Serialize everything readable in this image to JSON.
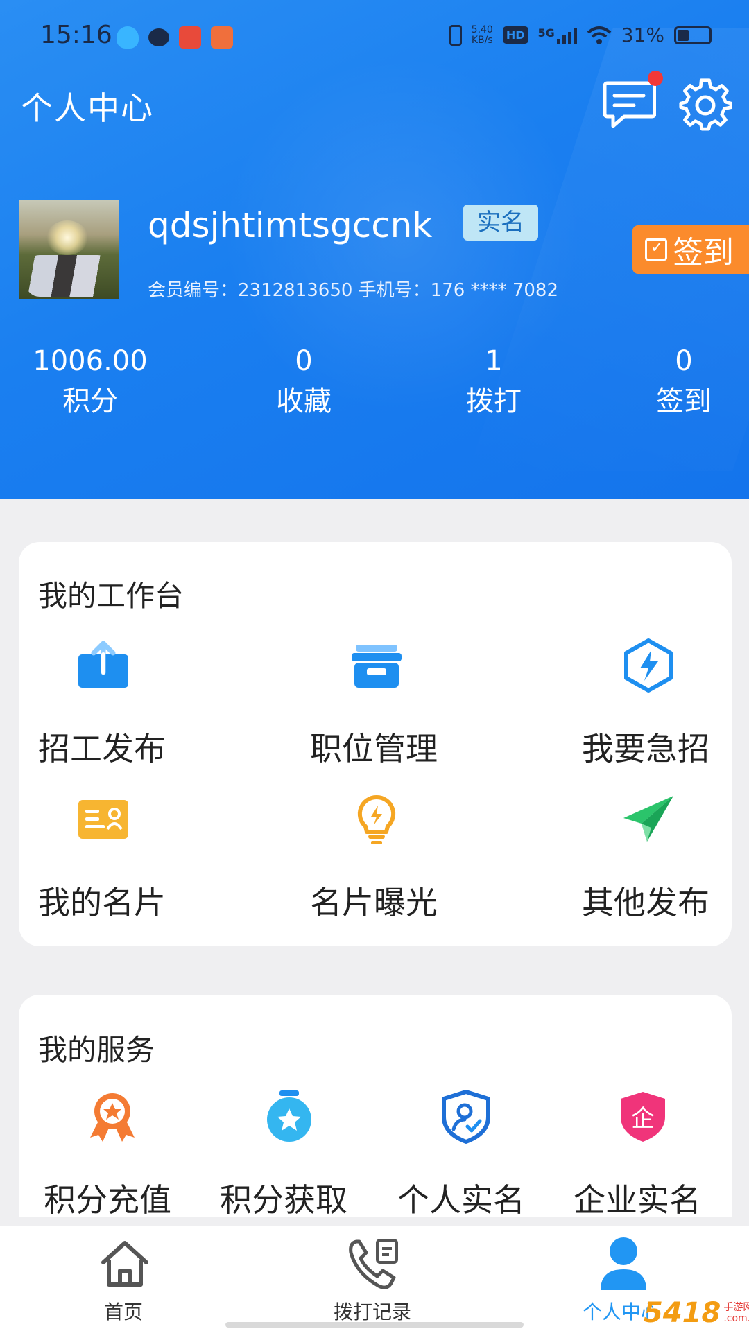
{
  "status_bar": {
    "time": "15:16",
    "net_speed_value": "5.40",
    "net_speed_unit": "KB/s",
    "hd": "HD",
    "network": "5G",
    "battery": "31%"
  },
  "header": {
    "title": "个人中心",
    "username": "qdsjhtimtsgccnk",
    "verified_badge": "实名",
    "member_info": "会员编号：2312813650 手机号：176 **** 7082",
    "checkin_label": "签到"
  },
  "stats": [
    {
      "value": "1006.00",
      "label": "积分"
    },
    {
      "value": "0",
      "label": "收藏"
    },
    {
      "value": "1",
      "label": "拨打"
    },
    {
      "value": "0",
      "label": "签到"
    }
  ],
  "workbench": {
    "title": "我的工作台",
    "items": [
      {
        "label": "招工发布",
        "icon": "upload-icon"
      },
      {
        "label": "职位管理",
        "icon": "archive-box-icon"
      },
      {
        "label": "我要急招",
        "icon": "lightning-icon"
      },
      {
        "label": "我的名片",
        "icon": "business-card-icon"
      },
      {
        "label": "名片曝光",
        "icon": "lightbulb-icon"
      },
      {
        "label": "其他发布",
        "icon": "paper-plane-icon"
      }
    ]
  },
  "services": {
    "title": "我的服务",
    "items": [
      {
        "label": "积分充值",
        "icon": "medal-icon"
      },
      {
        "label": "积分获取",
        "icon": "star-badge-icon"
      },
      {
        "label": "个人实名",
        "icon": "person-shield-icon"
      },
      {
        "label": "企业实名",
        "icon": "enterprise-shield-icon"
      }
    ]
  },
  "tabbar": {
    "tabs": [
      {
        "label": "首页",
        "icon": "home-icon"
      },
      {
        "label": "拨打记录",
        "icon": "phone-record-icon"
      },
      {
        "label": "个人中心",
        "icon": "person-icon"
      }
    ]
  },
  "watermark": {
    "brand": "5418",
    "text1": "手游网",
    "text2": ".com.cn"
  },
  "colors": {
    "header_blue": "#1a7ff0",
    "checkin_orange": "#fb8b2c",
    "accent_blue": "#2196f3",
    "tab_active": "#2196f3"
  }
}
